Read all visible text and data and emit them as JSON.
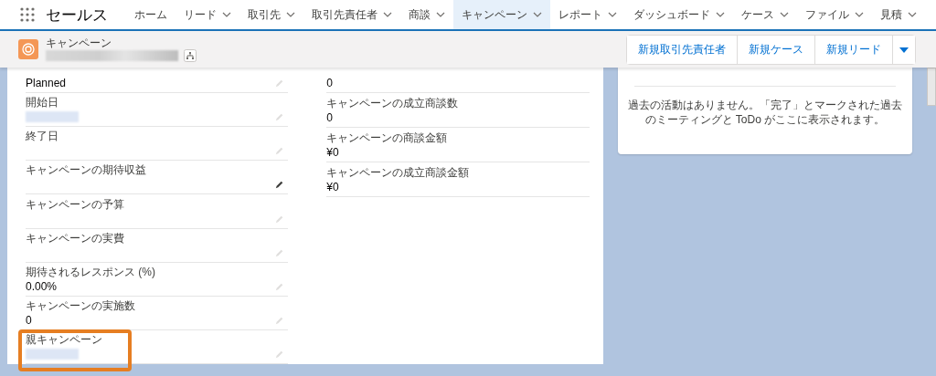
{
  "nav": {
    "app_name": "セールス",
    "tabs": [
      {
        "label": "ホーム",
        "selected": false,
        "dropdown": false
      },
      {
        "label": "リード",
        "selected": false,
        "dropdown": true
      },
      {
        "label": "取引先",
        "selected": false,
        "dropdown": true
      },
      {
        "label": "取引先責任者",
        "selected": false,
        "dropdown": true
      },
      {
        "label": "商談",
        "selected": false,
        "dropdown": true
      },
      {
        "label": "キャンペーン",
        "selected": true,
        "dropdown": true
      },
      {
        "label": "レポート",
        "selected": false,
        "dropdown": true
      },
      {
        "label": "ダッシュボード",
        "selected": false,
        "dropdown": true
      },
      {
        "label": "ケース",
        "selected": false,
        "dropdown": true
      },
      {
        "label": "ファイル",
        "selected": false,
        "dropdown": true
      },
      {
        "label": "見積",
        "selected": false,
        "dropdown": true
      }
    ]
  },
  "header": {
    "object_label": "キャンペーン",
    "actions": [
      "新規取引先責任者",
      "新規ケース",
      "新規リード"
    ]
  },
  "details": {
    "left": [
      {
        "value": "Planned",
        "kind": "text",
        "edit_active": false,
        "highlighted": false
      },
      {
        "label": "開始日",
        "kind": "redacted",
        "edit_active": false,
        "highlighted": false
      },
      {
        "label": "終了日",
        "kind": "text",
        "edit_active": false,
        "highlighted": false
      },
      {
        "label": "キャンペーンの期待収益",
        "kind": "text",
        "edit_active": true,
        "highlighted": false
      },
      {
        "label": "キャンペーンの予算",
        "kind": "text",
        "edit_active": false,
        "highlighted": false
      },
      {
        "label": "キャンペーンの実費",
        "kind": "text",
        "edit_active": false,
        "highlighted": false
      },
      {
        "label": "期待されるレスポンス (%)",
        "value": "0.00%",
        "kind": "text",
        "edit_active": false,
        "highlighted": false
      },
      {
        "label": "キャンペーンの実施数",
        "value": "0",
        "kind": "text",
        "edit_active": false,
        "highlighted": false
      },
      {
        "label": "親キャンペーン",
        "kind": "redacted",
        "edit_active": false,
        "highlighted": true
      }
    ],
    "right": [
      {
        "value": "0"
      },
      {
        "label": "キャンペーンの成立商談数",
        "value": "0"
      },
      {
        "label": "キャンペーンの商談金額",
        "value": "¥0"
      },
      {
        "label": "キャンペーンの成立商談金額",
        "value": "¥0"
      }
    ]
  },
  "activity": {
    "message": "過去の活動はありません。「完了」とマークされた過去のミーティングと ToDo がここに表示されます。"
  }
}
